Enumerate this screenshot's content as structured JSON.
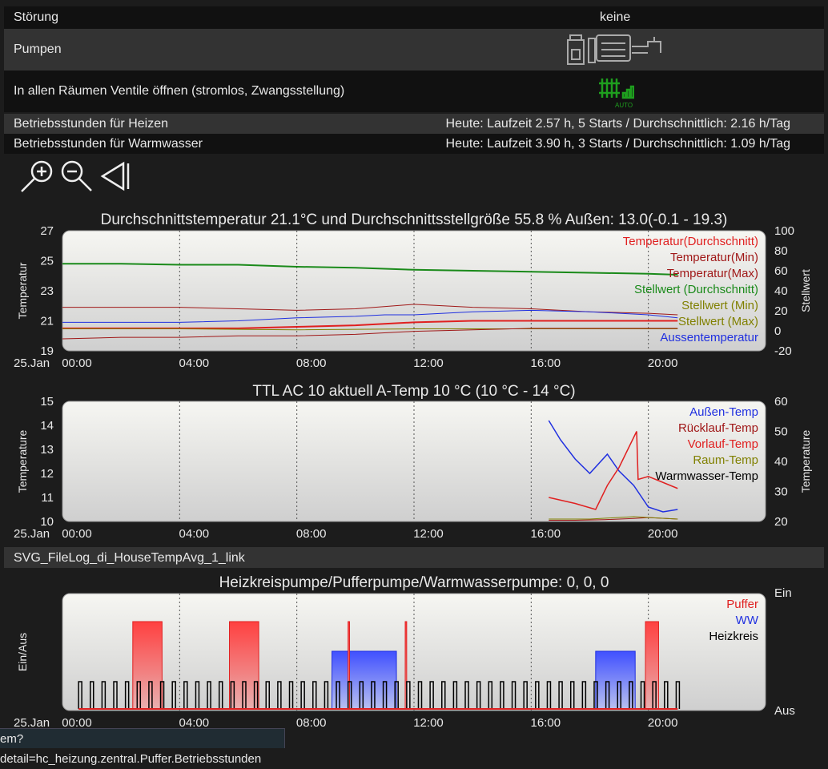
{
  "rows": {
    "stoerung": {
      "label": "Störung",
      "value": "keine"
    },
    "pumpen": {
      "label": "Pumpen",
      "icon": "heating-system-icon"
    },
    "ventile": {
      "label": "In allen Räumen Ventile öffnen (stromlos, Zwangsstellung)",
      "icon": "radiator-auto-icon",
      "icon_text": "AUTO"
    },
    "heizen": {
      "label": "Betriebsstunden für Heizen",
      "value": "Heute: Laufzeit 2.57 h, 5 Starts / Durchschnittlich: 2.16 h/Tag"
    },
    "warmwasser": {
      "label": "Betriebsstunden für Warmwasser",
      "value": "Heute: Laufzeit 3.90 h, 3 Starts / Durchschnittlich: 1.09 h/Tag"
    },
    "filelog": {
      "label": "SVG_FileLog_di_HouseTempAvg_1_link"
    }
  },
  "toolbar": {
    "icons": [
      "zoom-in-icon",
      "zoom-out-icon",
      "back-icon"
    ]
  },
  "status_url": "em?detail=hc_heizung.zentral.Puffer.Betriebsstunden",
  "colors": {
    "red": "#e02020",
    "darkred": "#a01818",
    "green": "#1a8a1a",
    "olive": "#808000",
    "blue": "#2030e0",
    "black": "#000000",
    "grid": "#555555"
  },
  "x_ticks": [
    "00:00",
    "04:00",
    "08:00",
    "12:00",
    "16:00",
    "20:00"
  ],
  "date_label": "25.Jan",
  "chart_data": [
    {
      "type": "line",
      "title": "Durchschnittstemperatur 21.1°C und Durchschnittsstellgröße 55.8 % Außen: 13.0(-0.1 - 19.3)",
      "ylabel": "Temperatur",
      "y2label": "Stellwert",
      "ylim": [
        19,
        27
      ],
      "y_ticks": [
        "27",
        "25",
        "23",
        "21",
        "19"
      ],
      "y2lim": [
        -20,
        100
      ],
      "y2_ticks": [
        "100",
        "80",
        "60",
        "40",
        "20",
        "0",
        "-20"
      ],
      "xlim_hours": [
        0,
        24
      ],
      "legend": [
        "Temperatur(Durchschnitt)",
        "Temperatur(Min)",
        "Temperatur(Max)",
        "Stellwert (Durchschnitt)",
        "Stellwert (Min)",
        "Stellwert (Max)",
        "Aussentemperatur"
      ],
      "legend_colors": [
        "red",
        "darkred",
        "darkred",
        "green",
        "olive",
        "olive",
        "blue"
      ],
      "series": [
        {
          "name": "Stellwert (Durchschnitt)",
          "axis": "y2",
          "color": "green",
          "width": 2,
          "x": [
            0,
            1,
            2,
            4,
            6,
            8,
            10,
            12,
            14,
            16,
            18,
            20,
            21
          ],
          "y": [
            67,
            67,
            67,
            66,
            66,
            64,
            63,
            61,
            60,
            59,
            58,
            57,
            56
          ]
        },
        {
          "name": "Temperatur(Max)",
          "axis": "y",
          "color": "darkred",
          "width": 1,
          "x": [
            0,
            2,
            4,
            6,
            8,
            10,
            12,
            14,
            16,
            18,
            20,
            21
          ],
          "y": [
            21.9,
            21.9,
            21.9,
            21.8,
            21.7,
            21.8,
            22.1,
            21.9,
            21.8,
            21.6,
            21.5,
            21.4
          ]
        },
        {
          "name": "Aussentemperatur",
          "axis": "y",
          "color": "blue",
          "width": 1,
          "x": [
            0,
            0.5,
            1,
            2,
            4,
            6,
            8,
            10,
            11,
            12,
            13,
            14,
            16,
            18,
            20,
            21
          ],
          "y": [
            20.9,
            20.9,
            20.9,
            20.9,
            20.9,
            21.0,
            21.2,
            21.3,
            21.4,
            21.4,
            21.5,
            21.6,
            21.7,
            21.6,
            21.4,
            21.2
          ]
        },
        {
          "name": "Temperatur(Durchschnitt)",
          "axis": "y",
          "color": "red",
          "width": 2,
          "x": [
            0,
            2,
            4,
            6,
            8,
            10,
            12,
            14,
            16,
            18,
            20,
            21
          ],
          "y": [
            20.5,
            20.5,
            20.5,
            20.5,
            20.6,
            20.7,
            20.9,
            21.0,
            21.0,
            21.0,
            21.0,
            21.0
          ]
        },
        {
          "name": "Stellwert (Max)",
          "axis": "y2",
          "color": "olive",
          "width": 1,
          "x": [
            0,
            4,
            8,
            12,
            16,
            20,
            21
          ],
          "y": [
            2,
            2,
            1,
            2,
            2,
            2,
            2
          ]
        },
        {
          "name": "Temperatur(Min)",
          "axis": "y",
          "color": "darkred",
          "width": 1,
          "x": [
            0,
            2,
            4,
            6,
            8,
            10,
            12,
            14,
            16,
            18,
            20,
            21
          ],
          "y": [
            19.8,
            19.9,
            19.9,
            20.0,
            20.0,
            20.1,
            20.3,
            20.4,
            20.5,
            20.5,
            20.5,
            20.5
          ]
        }
      ]
    },
    {
      "type": "line",
      "title": "TTL AC 10 aktuell A-Temp 10 °C (10 °C - 14 °C)",
      "ylabel": "Temperature",
      "y2label": "Temperature",
      "ylim": [
        10,
        15
      ],
      "y_ticks": [
        "15",
        "14",
        "13",
        "12",
        "11",
        "10"
      ],
      "y2lim": [
        20,
        60
      ],
      "y2_ticks": [
        "60",
        "50",
        "40",
        "30",
        "20"
      ],
      "xlim_hours": [
        0,
        24
      ],
      "legend": [
        "Außen-Temp",
        "Rücklauf-Temp",
        "Vorlauf-Temp",
        "Raum-Temp",
        "Warmwasser-Temp"
      ],
      "legend_colors": [
        "blue",
        "darkred",
        "red",
        "olive",
        "black"
      ],
      "series": [
        {
          "name": "Außen-Temp",
          "axis": "y",
          "color": "blue",
          "width": 1.5,
          "x": [
            16.6,
            17.0,
            17.5,
            18.0,
            18.6,
            19.0,
            19.5,
            20.0,
            20.5,
            21.0
          ],
          "y": [
            14.2,
            13.4,
            12.6,
            12.0,
            12.8,
            12.1,
            11.5,
            10.6,
            10.4,
            10.5
          ]
        },
        {
          "name": "Vorlauf-Temp",
          "axis": "y2",
          "color": "red",
          "width": 1.5,
          "x": [
            16.6,
            17.5,
            18.2,
            18.6,
            19.0,
            19.5,
            19.6,
            19.65,
            20.0,
            21.0
          ],
          "y": [
            28,
            26,
            24,
            32,
            38,
            48,
            50,
            34,
            35,
            31
          ]
        },
        {
          "name": "Rücklauf-Temp",
          "axis": "y2",
          "color": "darkred",
          "width": 1,
          "x": [
            16.6,
            17.5,
            18.5,
            19.5,
            20.0,
            21.0
          ],
          "y": [
            20.4,
            20.4,
            20.6,
            21.0,
            21.3,
            20.8
          ]
        },
        {
          "name": "Raum-Temp",
          "axis": "y",
          "color": "olive",
          "width": 1,
          "x": [
            16.6,
            18.0,
            19.5,
            21.0
          ],
          "y": [
            10.1,
            10.1,
            10.2,
            10.1
          ]
        }
      ]
    },
    {
      "type": "area",
      "title": "Heizkreispumpe/Pufferpumpe/Warmwasserpumpe: 0, 0, 0",
      "ylabel": "Ein/Aus",
      "y_ticks_right": [
        "Ein",
        "Aus"
      ],
      "xlim_hours": [
        0,
        24
      ],
      "legend": [
        "Puffer",
        "WW",
        "Heizkreis"
      ],
      "legend_colors": [
        "red",
        "blue",
        "black"
      ],
      "intervals": {
        "Puffer": [
          [
            2.4,
            3.4
          ],
          [
            5.7,
            6.7
          ],
          [
            9.75,
            9.8
          ],
          [
            11.7,
            11.75
          ],
          [
            19.9,
            20.35
          ]
        ],
        "WW": [
          [
            9.2,
            11.4
          ],
          [
            18.2,
            19.55
          ]
        ],
        "Heizkreis_pulses_start": 0.55,
        "Heizkreis_pulses_step": 0.4,
        "Heizkreis_pulses_end": 21.0
      }
    }
  ]
}
